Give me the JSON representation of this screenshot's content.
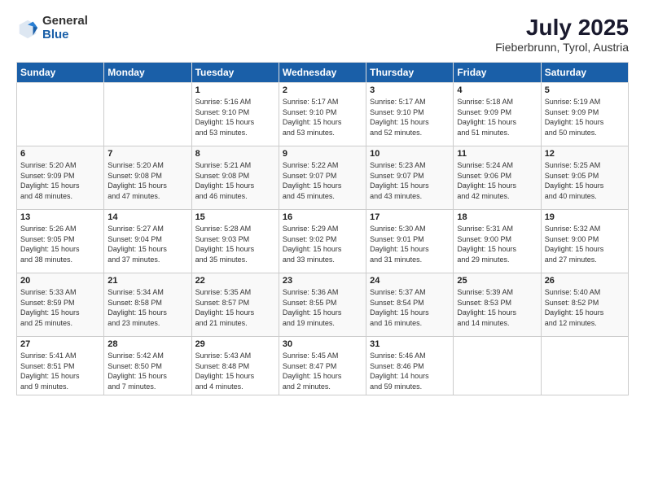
{
  "header": {
    "logo_general": "General",
    "logo_blue": "Blue",
    "month_year": "July 2025",
    "location": "Fieberbrunn, Tyrol, Austria"
  },
  "days_of_week": [
    "Sunday",
    "Monday",
    "Tuesday",
    "Wednesday",
    "Thursday",
    "Friday",
    "Saturday"
  ],
  "weeks": [
    [
      {
        "day": "",
        "info": ""
      },
      {
        "day": "",
        "info": ""
      },
      {
        "day": "1",
        "info": "Sunrise: 5:16 AM\nSunset: 9:10 PM\nDaylight: 15 hours\nand 53 minutes."
      },
      {
        "day": "2",
        "info": "Sunrise: 5:17 AM\nSunset: 9:10 PM\nDaylight: 15 hours\nand 53 minutes."
      },
      {
        "day": "3",
        "info": "Sunrise: 5:17 AM\nSunset: 9:10 PM\nDaylight: 15 hours\nand 52 minutes."
      },
      {
        "day": "4",
        "info": "Sunrise: 5:18 AM\nSunset: 9:09 PM\nDaylight: 15 hours\nand 51 minutes."
      },
      {
        "day": "5",
        "info": "Sunrise: 5:19 AM\nSunset: 9:09 PM\nDaylight: 15 hours\nand 50 minutes."
      }
    ],
    [
      {
        "day": "6",
        "info": "Sunrise: 5:20 AM\nSunset: 9:09 PM\nDaylight: 15 hours\nand 48 minutes."
      },
      {
        "day": "7",
        "info": "Sunrise: 5:20 AM\nSunset: 9:08 PM\nDaylight: 15 hours\nand 47 minutes."
      },
      {
        "day": "8",
        "info": "Sunrise: 5:21 AM\nSunset: 9:08 PM\nDaylight: 15 hours\nand 46 minutes."
      },
      {
        "day": "9",
        "info": "Sunrise: 5:22 AM\nSunset: 9:07 PM\nDaylight: 15 hours\nand 45 minutes."
      },
      {
        "day": "10",
        "info": "Sunrise: 5:23 AM\nSunset: 9:07 PM\nDaylight: 15 hours\nand 43 minutes."
      },
      {
        "day": "11",
        "info": "Sunrise: 5:24 AM\nSunset: 9:06 PM\nDaylight: 15 hours\nand 42 minutes."
      },
      {
        "day": "12",
        "info": "Sunrise: 5:25 AM\nSunset: 9:05 PM\nDaylight: 15 hours\nand 40 minutes."
      }
    ],
    [
      {
        "day": "13",
        "info": "Sunrise: 5:26 AM\nSunset: 9:05 PM\nDaylight: 15 hours\nand 38 minutes."
      },
      {
        "day": "14",
        "info": "Sunrise: 5:27 AM\nSunset: 9:04 PM\nDaylight: 15 hours\nand 37 minutes."
      },
      {
        "day": "15",
        "info": "Sunrise: 5:28 AM\nSunset: 9:03 PM\nDaylight: 15 hours\nand 35 minutes."
      },
      {
        "day": "16",
        "info": "Sunrise: 5:29 AM\nSunset: 9:02 PM\nDaylight: 15 hours\nand 33 minutes."
      },
      {
        "day": "17",
        "info": "Sunrise: 5:30 AM\nSunset: 9:01 PM\nDaylight: 15 hours\nand 31 minutes."
      },
      {
        "day": "18",
        "info": "Sunrise: 5:31 AM\nSunset: 9:00 PM\nDaylight: 15 hours\nand 29 minutes."
      },
      {
        "day": "19",
        "info": "Sunrise: 5:32 AM\nSunset: 9:00 PM\nDaylight: 15 hours\nand 27 minutes."
      }
    ],
    [
      {
        "day": "20",
        "info": "Sunrise: 5:33 AM\nSunset: 8:59 PM\nDaylight: 15 hours\nand 25 minutes."
      },
      {
        "day": "21",
        "info": "Sunrise: 5:34 AM\nSunset: 8:58 PM\nDaylight: 15 hours\nand 23 minutes."
      },
      {
        "day": "22",
        "info": "Sunrise: 5:35 AM\nSunset: 8:57 PM\nDaylight: 15 hours\nand 21 minutes."
      },
      {
        "day": "23",
        "info": "Sunrise: 5:36 AM\nSunset: 8:55 PM\nDaylight: 15 hours\nand 19 minutes."
      },
      {
        "day": "24",
        "info": "Sunrise: 5:37 AM\nSunset: 8:54 PM\nDaylight: 15 hours\nand 16 minutes."
      },
      {
        "day": "25",
        "info": "Sunrise: 5:39 AM\nSunset: 8:53 PM\nDaylight: 15 hours\nand 14 minutes."
      },
      {
        "day": "26",
        "info": "Sunrise: 5:40 AM\nSunset: 8:52 PM\nDaylight: 15 hours\nand 12 minutes."
      }
    ],
    [
      {
        "day": "27",
        "info": "Sunrise: 5:41 AM\nSunset: 8:51 PM\nDaylight: 15 hours\nand 9 minutes."
      },
      {
        "day": "28",
        "info": "Sunrise: 5:42 AM\nSunset: 8:50 PM\nDaylight: 15 hours\nand 7 minutes."
      },
      {
        "day": "29",
        "info": "Sunrise: 5:43 AM\nSunset: 8:48 PM\nDaylight: 15 hours\nand 4 minutes."
      },
      {
        "day": "30",
        "info": "Sunrise: 5:45 AM\nSunset: 8:47 PM\nDaylight: 15 hours\nand 2 minutes."
      },
      {
        "day": "31",
        "info": "Sunrise: 5:46 AM\nSunset: 8:46 PM\nDaylight: 14 hours\nand 59 minutes."
      },
      {
        "day": "",
        "info": ""
      },
      {
        "day": "",
        "info": ""
      }
    ]
  ]
}
